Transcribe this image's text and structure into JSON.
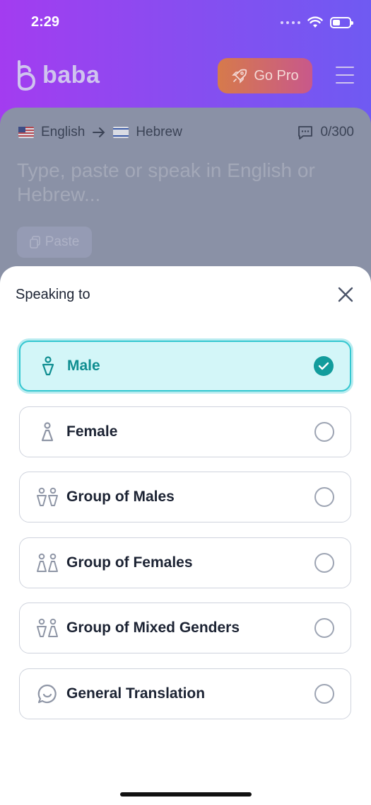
{
  "status_bar": {
    "time": "2:29"
  },
  "app": {
    "logo_text": "baba",
    "go_pro_label": "Go Pro"
  },
  "translator": {
    "source_language": "English",
    "target_language": "Hebrew",
    "char_count": "0/300",
    "placeholder": "Type, paste or speak in English or Hebrew...",
    "paste_label": "Paste"
  },
  "sheet": {
    "title": "Speaking to",
    "selected_index": 0,
    "options": [
      {
        "label": "Male",
        "icon": "male-icon",
        "selected": true
      },
      {
        "label": "Female",
        "icon": "female-icon",
        "selected": false
      },
      {
        "label": "Group of Males",
        "icon": "group-males-icon",
        "selected": false
      },
      {
        "label": "Group of Females",
        "icon": "group-females-icon",
        "selected": false
      },
      {
        "label": "Group of Mixed Genders",
        "icon": "group-mixed-icon",
        "selected": false
      },
      {
        "label": "General Translation",
        "icon": "chat-bubble-icon",
        "selected": false
      }
    ]
  },
  "colors": {
    "accent": "#129c9c",
    "selected_bg": "#d3f6f8",
    "selected_border": "#34c7d0",
    "gradient_start": "#a33cf0",
    "gradient_end": "#6f5af2"
  }
}
